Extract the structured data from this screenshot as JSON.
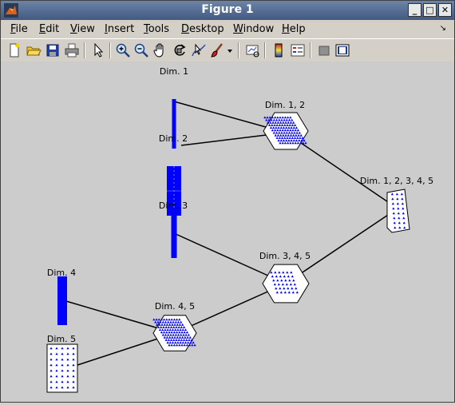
{
  "window": {
    "title": "Figure 1"
  },
  "menu": [
    {
      "key": "file",
      "mn": "F",
      "rest": "ile"
    },
    {
      "key": "edit",
      "mn": "E",
      "rest": "dit"
    },
    {
      "key": "view",
      "mn": "V",
      "rest": "iew"
    },
    {
      "key": "insert",
      "mn": "I",
      "rest": "nsert"
    },
    {
      "key": "tools",
      "mn": "T",
      "rest": "ools"
    },
    {
      "key": "desktop",
      "mn": "D",
      "rest": "esktop"
    },
    {
      "key": "window",
      "mn": "W",
      "rest": "indow"
    },
    {
      "key": "help",
      "mn": "H",
      "rest": "elp"
    }
  ],
  "toolbar_icons": [
    "new-figure-icon",
    "open-file-icon",
    "save-icon",
    "print-icon",
    "edit-plot-arrow-icon",
    "zoom-in-icon",
    "zoom-out-icon",
    "pan-hand-icon",
    "rotate-3d-icon",
    "data-cursor-icon",
    "brush-icon",
    "brush-dropdown-icon",
    "link-plot-icon",
    "colorbar-icon",
    "legend-icon",
    "hide-plot-tools-icon",
    "show-plot-tools-icon"
  ],
  "graph": {
    "nodes": [
      {
        "key": "dim1",
        "label": "Dim. 1",
        "shape": "bar"
      },
      {
        "key": "dim2",
        "label": "Dim. 2",
        "shape": "bar"
      },
      {
        "key": "dim3",
        "label": "Dim. 3",
        "shape": "bar"
      },
      {
        "key": "dim4",
        "label": "Dim. 4",
        "shape": "bar"
      },
      {
        "key": "dim5",
        "label": "Dim. 5",
        "shape": "box"
      },
      {
        "key": "dim12",
        "label": "Dim. 1, 2",
        "shape": "hexagon"
      },
      {
        "key": "dim345",
        "label": "Dim. 3, 4, 5",
        "shape": "hexagon"
      },
      {
        "key": "dim45",
        "label": "Dim. 4, 5",
        "shape": "hexagon"
      },
      {
        "key": "dim12345",
        "label": "Dim. 1, 2, 3, 4, 5",
        "shape": "slab"
      }
    ],
    "edges": [
      [
        "dim1",
        "dim12"
      ],
      [
        "dim2",
        "dim12"
      ],
      [
        "dim12",
        "dim12345"
      ],
      [
        "dim3",
        "dim345"
      ],
      [
        "dim345",
        "dim12345"
      ],
      [
        "dim4",
        "dim45"
      ],
      [
        "dim5",
        "dim45"
      ],
      [
        "dim45",
        "dim345"
      ]
    ]
  },
  "colors": {
    "point": "#0000ff",
    "canvas": "#cccccc",
    "titlebar": "#435a80"
  }
}
